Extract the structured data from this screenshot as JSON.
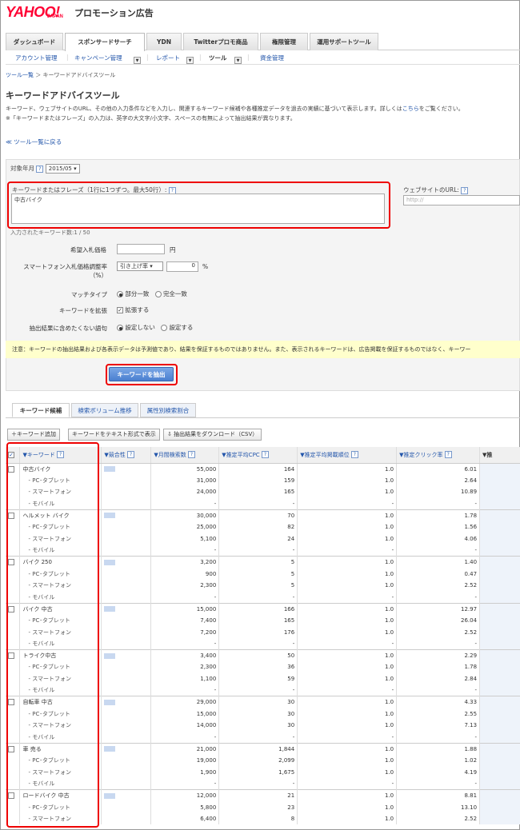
{
  "brand": {
    "logo": "YAHOO!",
    "logo_sub": "JAPAN",
    "product": "プロモーション広告"
  },
  "main_tabs": [
    "ダッシュボード",
    "スポンサードサーチ",
    "YDN",
    "Twitterプロモ商品",
    "権限管理",
    "運用サポートツール"
  ],
  "sub_nav": {
    "account": "アカウント管理",
    "campaign": "キャンペーン管理",
    "report": "レポート",
    "tool": "ツール",
    "funds": "資金管理"
  },
  "breadcrumb": {
    "parent": "ツール一覧",
    "current": "キーワードアドバイスツール"
  },
  "page_title": "キーワードアドバイスツール",
  "description": {
    "line1": "キーワード、ウェブサイトのURL、その他の入力条件などを入力し、関連するキーワード候補や各種推定データを過去の実績に基づいて表示します。詳しくは",
    "link": "こちら",
    "line1_end": "をご覧ください。",
    "line2": "※「キーワードまたはフレーズ」の入力は、英字の大文字/小文字、スペースの有無によって抽出結果が異なります。"
  },
  "back_link": "≪ ツール一覧に戻る",
  "form": {
    "target_month_label": "対象年月",
    "target_month_value": "2015/05 ▾",
    "keyword_label": "キーワードまたはフレーズ（1行に1つずつ。最大50行）:",
    "keyword_value": "中古バイク",
    "website_label": "ウェブサイトのURL:",
    "website_placeholder": "http://",
    "count_label": "入力されたキーワード数:1 / 50",
    "bid_label": "希望入札価格",
    "bid_unit": "円",
    "sp_label_1": "スマートフォン入札価格調整率",
    "sp_label_2": "（%）",
    "sp_select": "引き上げ率 ▾",
    "sp_value": "0",
    "sp_unit": "%",
    "match_label": "マッチタイプ",
    "match_opt1": "部分一致",
    "match_opt2": "完全一致",
    "expand_label": "キーワードを拡張",
    "expand_opt": "拡張する",
    "exclude_label": "抽出結果に含めたくない語句",
    "exclude_opt1": "設定しない",
    "exclude_opt2": "設定する",
    "notice": "注意：キーワードの抽出結果および各表示データは予測値であり、結果を保証するものではありません。また、表示されるキーワードは、広告掲載を保証するものではなく、キーワー",
    "extract_button": "キーワードを抽出"
  },
  "result_tabs": [
    "キーワード候補",
    "検索ボリューム推移",
    "属性別検索割合"
  ],
  "toolbar": {
    "add": "＋キーワード追加",
    "text": "キーワードをテキスト形式で表示",
    "download": "抽出結果をダウンロード（CSV）"
  },
  "table": {
    "headers": [
      "キーワード",
      "競合性",
      "月間検索数",
      "推定平均CPC",
      "推定平均掲載順位",
      "推定クリック率",
      "▼推"
    ],
    "groups": [
      {
        "kw": "中古バイク",
        "rows": [
          [
            "55,000",
            "164",
            "1.0",
            "6.01"
          ],
          [
            "31,000",
            "159",
            "1.0",
            "2.64"
          ],
          [
            "24,000",
            "165",
            "1.0",
            "10.89"
          ],
          [
            "-",
            "-",
            "-",
            "-"
          ]
        ]
      },
      {
        "kw": "ヘルメット バイク",
        "rows": [
          [
            "30,000",
            "70",
            "1.0",
            "1.78"
          ],
          [
            "25,000",
            "82",
            "1.0",
            "1.56"
          ],
          [
            "5,100",
            "24",
            "1.0",
            "4.06"
          ],
          [
            "-",
            "-",
            "-",
            "-"
          ]
        ]
      },
      {
        "kw": "バイク 250",
        "rows": [
          [
            "3,200",
            "5",
            "1.0",
            "1.40"
          ],
          [
            "900",
            "5",
            "1.0",
            "0.47"
          ],
          [
            "2,300",
            "5",
            "1.0",
            "2.52"
          ],
          [
            "-",
            "-",
            "-",
            "-"
          ]
        ]
      },
      {
        "kw": "バイク 中古",
        "rows": [
          [
            "15,000",
            "166",
            "1.0",
            "12.97"
          ],
          [
            "7,400",
            "165",
            "1.0",
            "26.04"
          ],
          [
            "7,200",
            "176",
            "1.0",
            "2.52"
          ],
          [
            "-",
            "-",
            "-",
            "-"
          ]
        ]
      },
      {
        "kw": "トライク中古",
        "rows": [
          [
            "3,400",
            "50",
            "1.0",
            "2.29"
          ],
          [
            "2,300",
            "36",
            "1.0",
            "1.78"
          ],
          [
            "1,100",
            "59",
            "1.0",
            "2.84"
          ],
          [
            "-",
            "-",
            "-",
            "-"
          ]
        ]
      },
      {
        "kw": "自転車 中古",
        "rows": [
          [
            "29,000",
            "30",
            "1.0",
            "4.33"
          ],
          [
            "15,000",
            "30",
            "1.0",
            "2.55"
          ],
          [
            "14,000",
            "30",
            "1.0",
            "7.13"
          ],
          [
            "-",
            "-",
            "-",
            "-"
          ]
        ]
      },
      {
        "kw": "車 売る",
        "rows": [
          [
            "21,000",
            "1,844",
            "1.0",
            "1.88"
          ],
          [
            "19,000",
            "2,099",
            "1.0",
            "1.02"
          ],
          [
            "1,900",
            "1,675",
            "1.0",
            "4.19"
          ],
          [
            "-",
            "-",
            "-",
            "-"
          ]
        ]
      },
      {
        "kw": "ロードバイク 中古",
        "rows": [
          [
            "12,000",
            "21",
            "1.0",
            "8.81"
          ],
          [
            "5,800",
            "23",
            "1.0",
            "13.10"
          ],
          [
            "6,400",
            "8",
            "1.0",
            "2.52"
          ]
        ]
      }
    ],
    "sub_labels": [
      "- PC･タブレット",
      "- スマートフォン",
      "- モバイル"
    ]
  },
  "colors": {
    "accent": "#2255aa",
    "highlight": "#e00000",
    "notice_bg": "#ffffcc"
  }
}
